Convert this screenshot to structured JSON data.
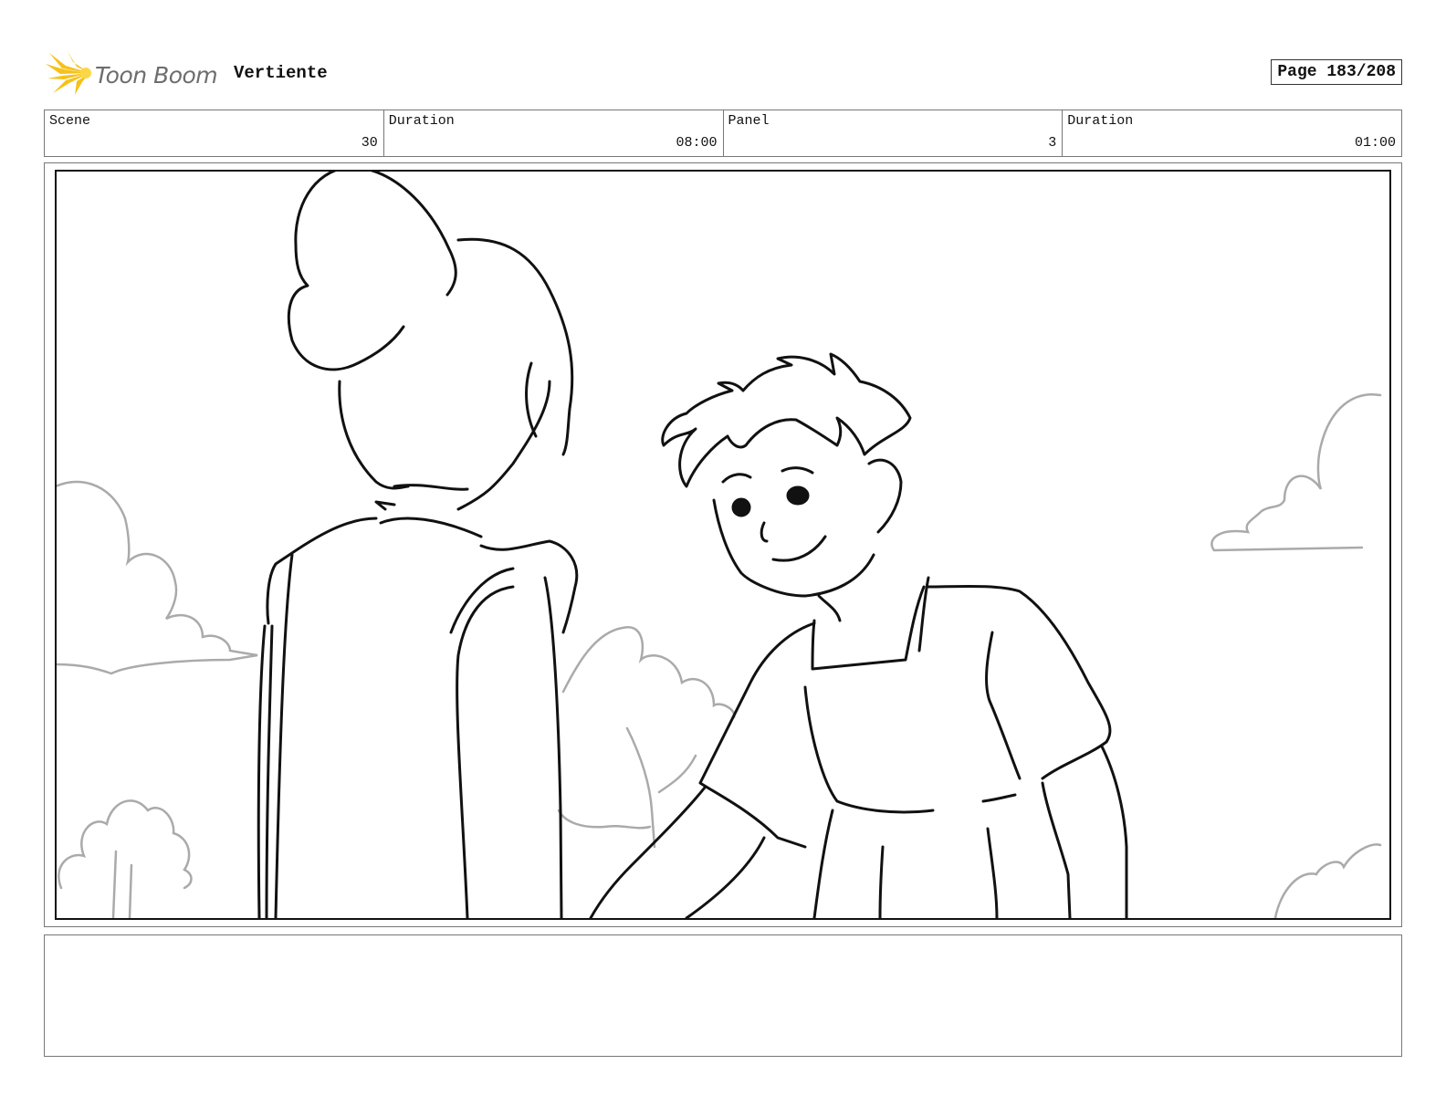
{
  "header": {
    "logo_text": "Toon Boom",
    "project_title": "Vertiente",
    "page_label": "Page 183/208"
  },
  "info": [
    {
      "label": "Scene",
      "value": "30"
    },
    {
      "label": "Duration",
      "value": "08:00"
    },
    {
      "label": "Panel",
      "value": "3"
    },
    {
      "label": "Duration",
      "value": "01:00"
    }
  ],
  "colors": {
    "logo_burst": "#f6c21a",
    "logo_text": "#6d6d6d",
    "ink": "#111111",
    "background_sketch": "#aaaaaa"
  },
  "icons": {
    "logo": "toon-boom-starburst-icon"
  },
  "notes": ""
}
